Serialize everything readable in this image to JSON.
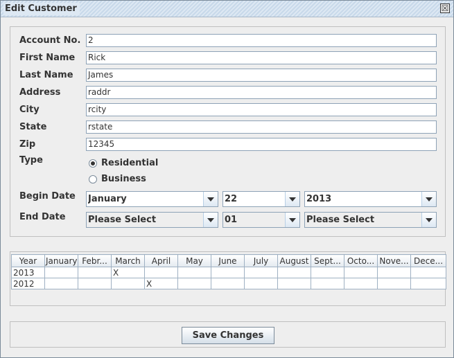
{
  "window": {
    "title": "Edit Customer",
    "close_glyph": "☒"
  },
  "form": {
    "account_no": {
      "label": "Account No.",
      "value": "2"
    },
    "first_name": {
      "label": "First Name",
      "value": "Rick"
    },
    "last_name": {
      "label": "Last Name",
      "value": "James"
    },
    "address": {
      "label": "Address",
      "value": "raddr"
    },
    "city": {
      "label": "City",
      "value": "rcity"
    },
    "state": {
      "label": "State",
      "value": "rstate"
    },
    "zip": {
      "label": "Zip",
      "value": "12345"
    },
    "type": {
      "label": "Type",
      "options": [
        {
          "label": "Residential",
          "selected": true
        },
        {
          "label": "Business",
          "selected": false
        }
      ]
    },
    "begin_date": {
      "label": "Begin Date",
      "month": "January",
      "day": "22",
      "year": "2013"
    },
    "end_date": {
      "label": "End Date",
      "month": "Please Select",
      "day": "01",
      "year": "Please Select"
    }
  },
  "table": {
    "columns": [
      "Year",
      "January",
      "Febr...",
      "March",
      "April",
      "May",
      "June",
      "July",
      "August",
      "Sept...",
      "Octo...",
      "Nove...",
      "Dece..."
    ],
    "rows": [
      [
        "2013",
        "",
        "",
        "X",
        "",
        "",
        "",
        "",
        "",
        "",
        "",
        "",
        ""
      ],
      [
        "2012",
        "",
        "",
        "",
        "X",
        "",
        "",
        "",
        "",
        "",
        "",
        "",
        ""
      ]
    ]
  },
  "buttons": {
    "save_label": "Save Changes"
  }
}
